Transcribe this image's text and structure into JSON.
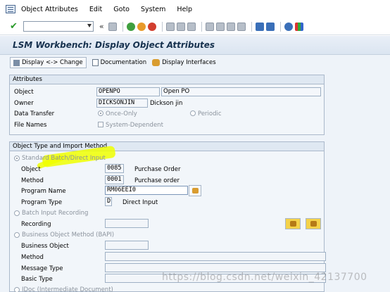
{
  "menu": {
    "items": [
      "Object Attributes",
      "Edit",
      "Goto",
      "System",
      "Help"
    ]
  },
  "toolbar": {
    "command_value": "",
    "icons": [
      "enter-icon",
      "save-icon",
      "back-icon",
      "exit-icon",
      "cancel-icon",
      "print-icon",
      "find-icon",
      "find-next-icon",
      "first-page-icon",
      "previous-page-icon",
      "next-page-icon",
      "last-page-icon",
      "create-session-icon",
      "shortcut-icon",
      "help-icon",
      "customize-layout-icon"
    ]
  },
  "title": "LSM Workbench: Display Object Attributes",
  "app_toolbar": {
    "display_change": "Display <-> Change",
    "documentation": "Documentation",
    "display_interfaces": "Display Interfaces"
  },
  "attributes": {
    "heading": "Attributes",
    "object_label": "Object",
    "object_value": "OPENPO",
    "object_desc": "Open PO",
    "owner_label": "Owner",
    "owner_value": "DICKSONJIN",
    "owner_desc": "Dickson jin",
    "data_transfer_label": "Data Transfer",
    "once_only": "Once-Only",
    "periodic": "Periodic",
    "file_names_label": "File Names",
    "system_dependent": "System-Dependent"
  },
  "import_method": {
    "heading": "Object Type and Import Method",
    "standard_batch": "Standard Batch/Direct Input",
    "object_label": "Object",
    "object_value": "0085",
    "object_desc": "Purchase Order",
    "method_label": "Method",
    "method_value": "0001",
    "method_desc": "Purchase order",
    "program_name_label": "Program Name",
    "program_name_value": "RM06EEI0",
    "program_type_label": "Program Type",
    "program_type_value": "D",
    "program_type_desc": "Direct Input",
    "batch_input_recording": "Batch Input Recording",
    "recording_label": "Recording",
    "business_object_method": "Business Object Method  (BAPI)",
    "business_object_label": "Business Object",
    "bo_method_label": "Method",
    "message_type_label": "Message Type",
    "basic_type_label": "Basic Type",
    "idoc": "IDoc (Intermediate Document)"
  },
  "watermark": "https://blog.csdn.net/weixin_42137700",
  "colors": {
    "title_text": "#17324f",
    "highlight": "#f0ff00",
    "enter_green": "#2a9a2a"
  }
}
